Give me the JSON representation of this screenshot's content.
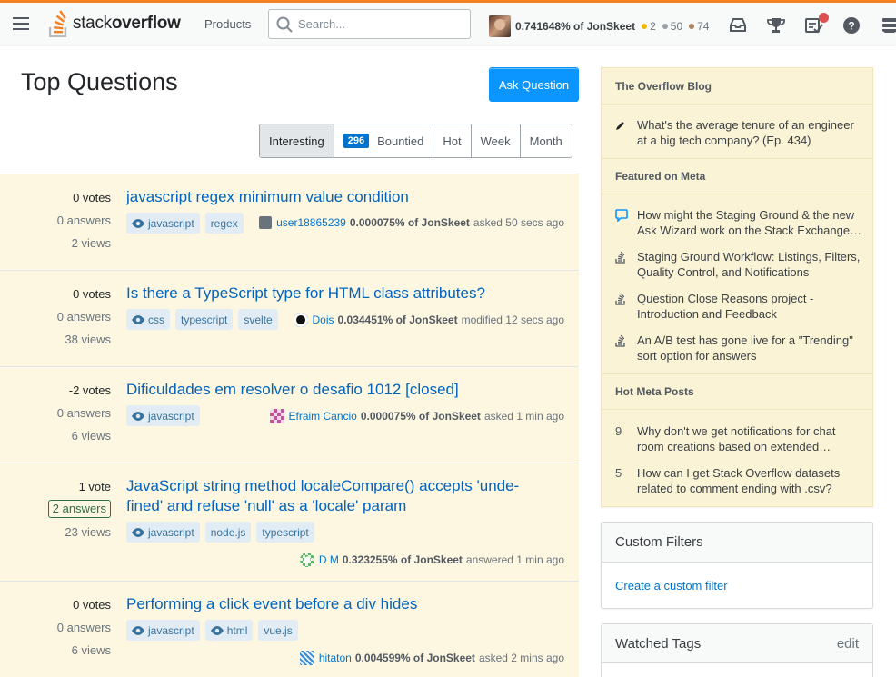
{
  "header": {
    "logo_light": "stack",
    "logo_bold": "overflow",
    "products_label": "Products",
    "search_placeholder": "Search...",
    "user_rep": "0.741648% of JonSkeet",
    "gold_count": "2",
    "silver_count": "50",
    "bronze_count": "74",
    "colors": {
      "accent": "#f48024",
      "gold": "#f1b600",
      "silver": "#9a9fa5",
      "bronze": "#ab825f"
    }
  },
  "main": {
    "title": "Top Questions",
    "ask_label": "Ask Question",
    "filters": {
      "interesting": "Interesting",
      "bounty_count": "296",
      "bountied": "Bountied",
      "hot": "Hot",
      "week": "Week",
      "month": "Month"
    },
    "questions": [
      {
        "votes": "0 votes",
        "answers": "0 answers",
        "views": "2 views",
        "title": "javascript regex minimum value condition",
        "tags": [
          "javascript",
          "regex"
        ],
        "user": "user18865239",
        "rep": "0.000075% of JonSkeet",
        "action": "asked 50 secs ago"
      },
      {
        "votes": "0 votes",
        "answers": "0 answers",
        "views": "38 views",
        "title": "Is there a TypeScript type for HTML class attributes?",
        "tags": [
          "css",
          "typescript",
          "svelte"
        ],
        "user": "Dois",
        "rep": "0.034451% of JonSkeet",
        "action": "modified 12 secs ago"
      },
      {
        "votes": "-2 votes",
        "answers": "0 answers",
        "views": "6 views",
        "title": "Dificuldades em resolver o desafio 1012 [closed]",
        "tags": [
          "javascript"
        ],
        "user": "Efraim Cancio",
        "rep": "0.000075% of JonSkeet",
        "action": "asked 1 min ago"
      },
      {
        "votes": "1 vote",
        "answers": "2 answers",
        "views": "23 views",
        "title_line1": "JavaScript string method localeCompare() accepts 'unde-",
        "title_line2": "fined' and refuse 'null' as a 'locale' param",
        "tags": [
          "javascript",
          "node.js",
          "typescript"
        ],
        "user": "D M",
        "rep": "0.323255% of JonSkeet",
        "action": "answered 1 min ago"
      },
      {
        "votes": "0 votes",
        "answers": "0 answers",
        "views": "6 views",
        "title": "Performing a click event before a div hides",
        "tags": [
          "javascript",
          "html",
          "vue.js"
        ],
        "user": "hitaton",
        "rep": "0.004599% of JonSkeet",
        "action": "asked 2 mins ago"
      }
    ]
  },
  "sidebar": {
    "blog_title": "The Overflow Blog",
    "blog_items": [
      {
        "text": "What's the average tenure of an engineer at a big tech company? (Ep. 434)"
      }
    ],
    "meta_title": "Featured on Meta",
    "meta_items": [
      {
        "text": "How might the Staging Ground & the new Ask Wizard work on the Stack Exchange…"
      },
      {
        "text": "Staging Ground Workflow: Listings, Filters, Quality Control, and Notifications"
      },
      {
        "text": "Question Close Reasons project - Introduction and Feedback"
      },
      {
        "text": "An A/B test has gone live for a \"Trending\" sort option for answers"
      }
    ],
    "hot_title": "Hot Meta Posts",
    "hot_items": [
      {
        "num": "9",
        "text": "Why don't we get notifications for chat room creations based on extended…"
      },
      {
        "num": "5",
        "text": "How can I get Stack Overflow datasets related to comment ending with .csv?"
      }
    ],
    "custom_filters_title": "Custom Filters",
    "custom_filter_link": "Create a custom filter",
    "watched_tags_title": "Watched Tags",
    "watched_tags_edit": "edit"
  }
}
